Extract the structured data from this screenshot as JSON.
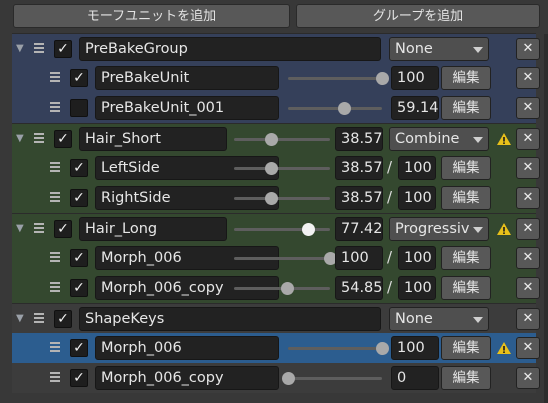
{
  "toolbar": {
    "add_unit_label": "モーフユニットを追加",
    "add_group_label": "グループを追加"
  },
  "icons": {
    "fold": "fold-triangle-icon",
    "handle": "drag-handle-icon",
    "warn": "warning-icon",
    "close": "close-icon"
  },
  "colors": {
    "accent_selected": "#2c5d8f",
    "group_blue": "#35405a",
    "group_green": "#34482f",
    "warning": "#e8c01a"
  },
  "rows": [
    {
      "kind": "group",
      "tint": "g-blue",
      "checked": true,
      "name": "PreBakeGroup",
      "slider": null,
      "value": "",
      "mode": "None",
      "warning": false
    },
    {
      "kind": "unit",
      "tint": "g-blue",
      "checked": true,
      "name": "PreBakeUnit",
      "slider": 1.0,
      "value": "100",
      "max": "",
      "edit": "編集"
    },
    {
      "kind": "unit",
      "tint": "g-blue",
      "checked": false,
      "name": "PreBakeUnit_001",
      "slider": 0.5914,
      "value": "59.14",
      "max": "",
      "edit": "編集"
    },
    {
      "kind": "group",
      "tint": "g-green",
      "checked": true,
      "name": "Hair_Short",
      "slider": 0.3857,
      "value": "38.57",
      "mode": "Combine",
      "warning": true
    },
    {
      "kind": "unit",
      "tint": "g-green",
      "checked": true,
      "name": "LeftSide",
      "slider": 0.3857,
      "value": "38.57",
      "max": "100",
      "edit": "編集"
    },
    {
      "kind": "unit",
      "tint": "g-green",
      "checked": true,
      "name": "RightSide",
      "slider": 0.3857,
      "value": "38.57",
      "max": "100",
      "edit": "編集"
    },
    {
      "kind": "group",
      "tint": "g-green",
      "checked": true,
      "name": "Hair_Long",
      "slider": 0.7742,
      "value": "77.42",
      "mode": "Progressiv",
      "warning": true,
      "white_knob": true
    },
    {
      "kind": "unit",
      "tint": "g-green",
      "checked": true,
      "name": "Morph_006",
      "slider": 1.0,
      "value": "100",
      "max": "100",
      "edit": "編集"
    },
    {
      "kind": "unit",
      "tint": "g-green",
      "checked": true,
      "name": "Morph_006_copy",
      "slider": 0.5485,
      "value": "54.85",
      "max": "100",
      "edit": "編集"
    },
    {
      "kind": "group",
      "tint": "g-gray",
      "checked": true,
      "name": "ShapeKeys",
      "slider": null,
      "value": "",
      "mode": "None",
      "warning": false
    },
    {
      "kind": "unit",
      "tint": "sel",
      "checked": true,
      "name": "Morph_006",
      "slider": 1.0,
      "value": "100",
      "max": "",
      "edit": "編集",
      "warning": true
    },
    {
      "kind": "unit",
      "tint": "g-gray",
      "checked": true,
      "name": "Morph_006_copy",
      "slider": 0.0,
      "value": "0",
      "max": "",
      "edit": "編集"
    }
  ]
}
